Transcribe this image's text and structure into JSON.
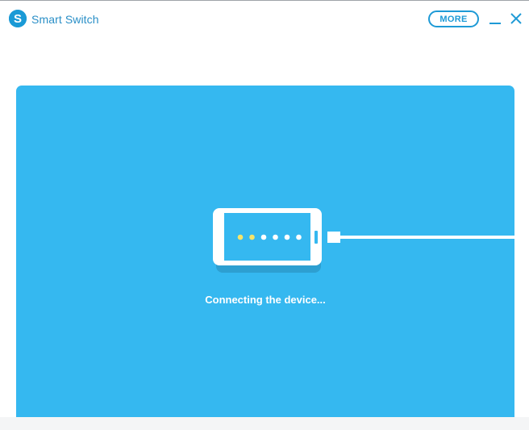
{
  "app": {
    "title": "Smart Switch",
    "logo_letter": "S"
  },
  "toolbar": {
    "more_label": "MORE"
  },
  "window_controls": {
    "minimize_icon": "minimize-icon",
    "close_icon": "close-icon"
  },
  "main": {
    "status_text": "Connecting the device...",
    "progress_dots": {
      "total": 6,
      "lit": 2
    }
  },
  "colors": {
    "accent": "#1e9ad6",
    "panel": "#35b8f0",
    "phone_screen": "#35b8f0",
    "dot_lit": "#f5e46a",
    "dot_unlit": "#ffffff"
  }
}
